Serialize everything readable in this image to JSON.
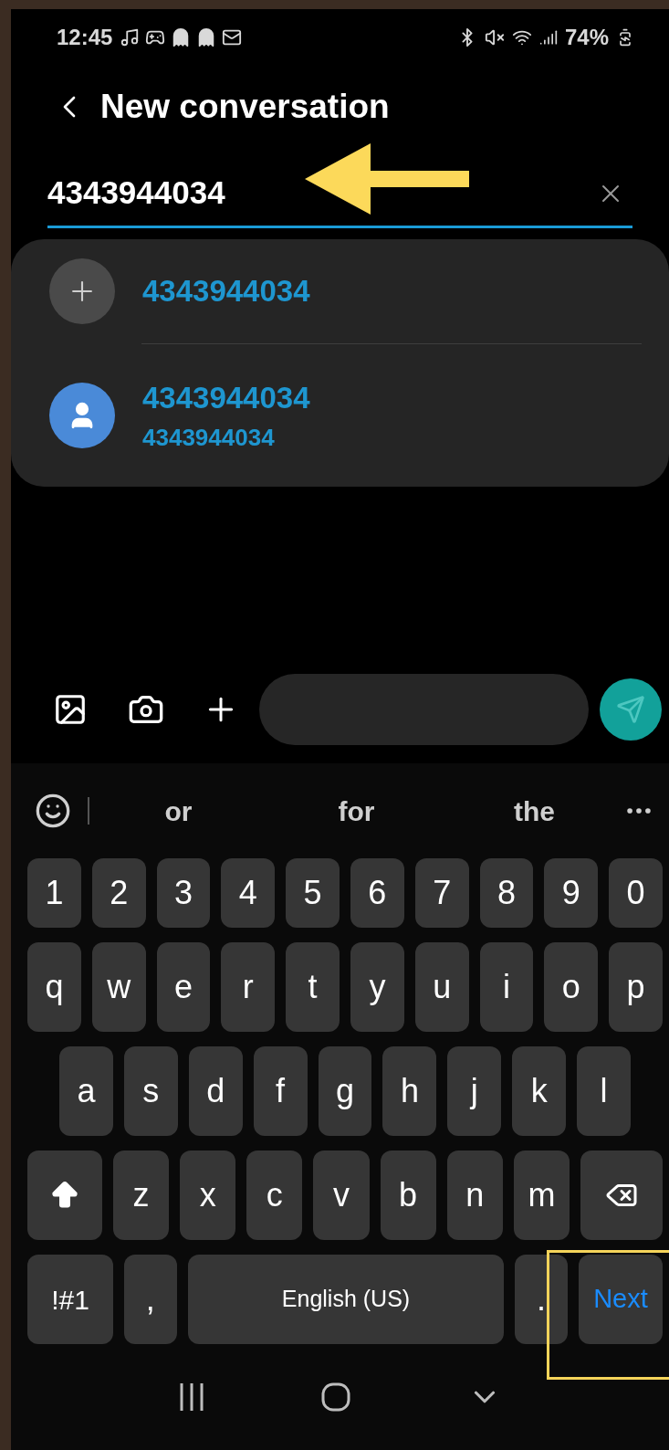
{
  "status_bar": {
    "time": "12:45",
    "battery": "74%"
  },
  "header": {
    "title": "New conversation"
  },
  "recipient_field": {
    "value": "4343944034"
  },
  "suggestions": [
    {
      "kind": "add",
      "title": "4343944034"
    },
    {
      "kind": "contact",
      "title": "4343944034",
      "subtitle": "4343944034"
    }
  ],
  "word_suggestions": [
    "or",
    "for",
    "the"
  ],
  "keyboard": {
    "rows": [
      {
        "keys": [
          {
            "kind": "char",
            "label": "1"
          },
          {
            "kind": "char",
            "label": "2"
          },
          {
            "kind": "char",
            "label": "3"
          },
          {
            "kind": "char",
            "label": "4"
          },
          {
            "kind": "char",
            "label": "5"
          },
          {
            "kind": "char",
            "label": "6"
          },
          {
            "kind": "char",
            "label": "7"
          },
          {
            "kind": "char",
            "label": "8"
          },
          {
            "kind": "char",
            "label": "9"
          },
          {
            "kind": "char",
            "label": "0"
          }
        ]
      },
      {
        "keys": [
          {
            "kind": "char",
            "label": "q"
          },
          {
            "kind": "char",
            "label": "w"
          },
          {
            "kind": "char",
            "label": "e"
          },
          {
            "kind": "char",
            "label": "r"
          },
          {
            "kind": "char",
            "label": "t"
          },
          {
            "kind": "char",
            "label": "y"
          },
          {
            "kind": "char",
            "label": "u"
          },
          {
            "kind": "char",
            "label": "i"
          },
          {
            "kind": "char",
            "label": "o"
          },
          {
            "kind": "char",
            "label": "p"
          }
        ]
      },
      {
        "keys": [
          {
            "kind": "char",
            "label": "a"
          },
          {
            "kind": "char",
            "label": "s"
          },
          {
            "kind": "char",
            "label": "d"
          },
          {
            "kind": "char",
            "label": "f"
          },
          {
            "kind": "char",
            "label": "g"
          },
          {
            "kind": "char",
            "label": "h"
          },
          {
            "kind": "char",
            "label": "j"
          },
          {
            "kind": "char",
            "label": "k"
          },
          {
            "kind": "char",
            "label": "l"
          }
        ]
      },
      {
        "keys": [
          {
            "kind": "shift"
          },
          {
            "kind": "char",
            "label": "z"
          },
          {
            "kind": "char",
            "label": "x"
          },
          {
            "kind": "char",
            "label": "c"
          },
          {
            "kind": "char",
            "label": "v"
          },
          {
            "kind": "char",
            "label": "b"
          },
          {
            "kind": "char",
            "label": "n"
          },
          {
            "kind": "char",
            "label": "m"
          },
          {
            "kind": "backspace"
          }
        ]
      }
    ],
    "bottom_row": {
      "symbols_key": "!#1",
      "comma_key": ",",
      "space_key": "English (US)",
      "period_key": ".",
      "action_key": "Next"
    }
  }
}
